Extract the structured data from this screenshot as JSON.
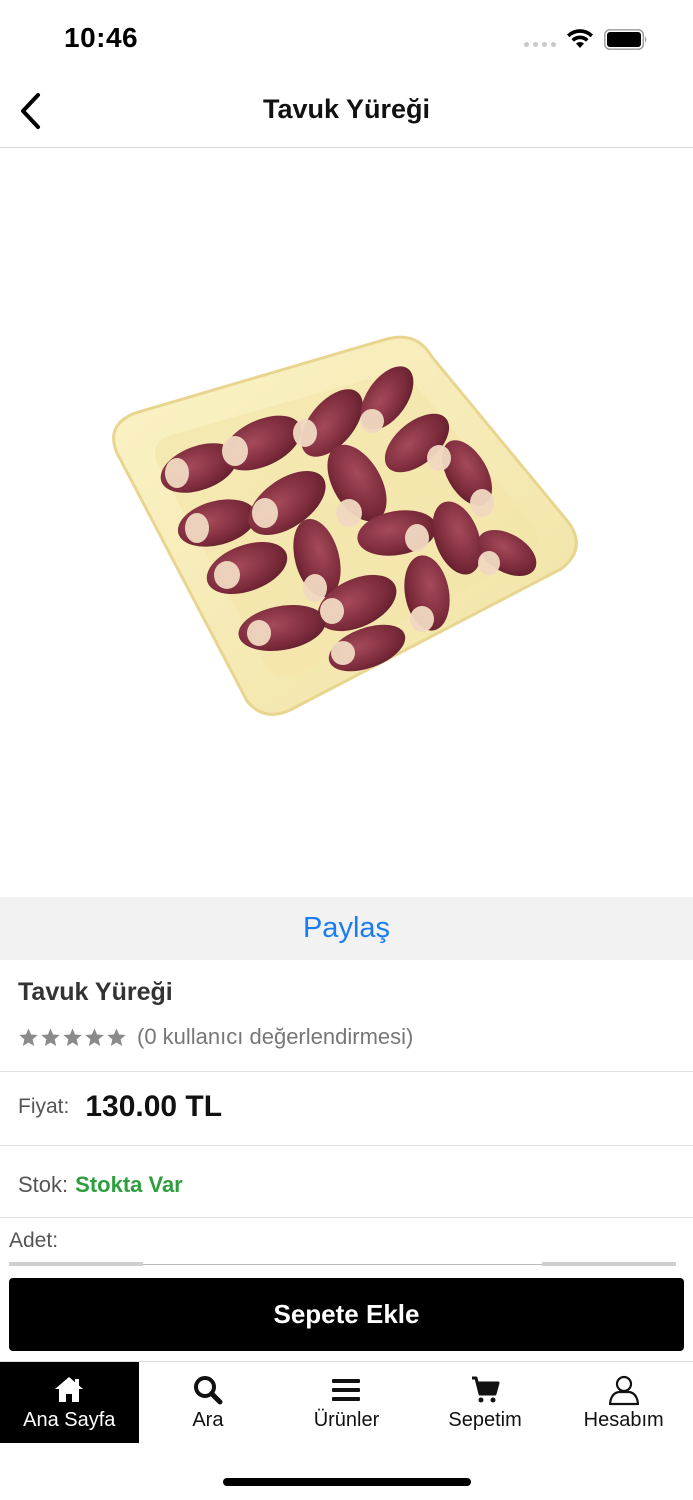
{
  "status_bar": {
    "time": "10:46"
  },
  "nav": {
    "title": "Tavuk Yüreği",
    "back_icon": "chevron-left-icon"
  },
  "product": {
    "image_alt": "Tavuk Yüreği",
    "share_label": "Paylaş",
    "name": "Tavuk Yüreği",
    "rating": {
      "stars": 0,
      "max_stars": 5,
      "text": "(0 kullanıcı değerlendirmesi)",
      "star_color": "#8a8a8a"
    },
    "price_label": "Fiyat:",
    "price_value": "130.00 TL",
    "stock_label": "Stok:",
    "stock_value": "Stokta Var",
    "stock_color": "#2e9e3e",
    "quantity_label": "Adet:",
    "quantity_value": "",
    "add_to_cart_label": "Sepete Ekle"
  },
  "tab_bar": {
    "items": [
      {
        "label": "Ana Sayfa",
        "icon": "home-icon",
        "active": true
      },
      {
        "label": "Ara",
        "icon": "search-icon",
        "active": false
      },
      {
        "label": "Ürünler",
        "icon": "menu-icon",
        "active": false
      },
      {
        "label": "Sepetim",
        "icon": "cart-icon",
        "active": false
      },
      {
        "label": "Hesabım",
        "icon": "user-icon",
        "active": false
      }
    ]
  },
  "colors": {
    "accent_link": "#1a7cf2",
    "button_bg": "#000000",
    "active_tab_bg": "#000000"
  }
}
